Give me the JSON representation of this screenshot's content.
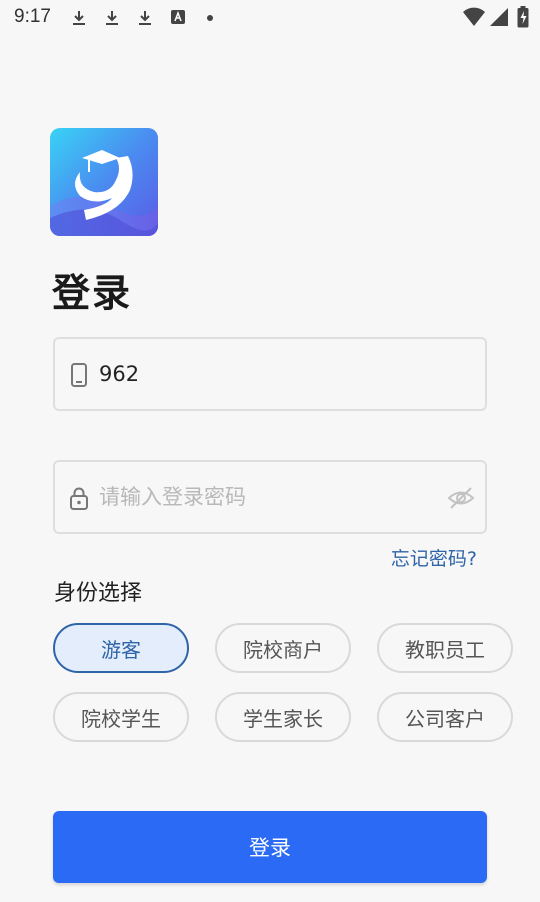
{
  "status_bar": {
    "time": "9:17",
    "icons": [
      "download-icon",
      "download-icon",
      "download-icon",
      "font-icon",
      "dot-icon",
      "wifi-icon",
      "signal-icon",
      "battery-charging-icon"
    ]
  },
  "page": {
    "title": "登录"
  },
  "phone_field": {
    "value": "962",
    "icon": "phone-icon"
  },
  "password_field": {
    "placeholder": "请输入登录密码",
    "icon": "lock-icon",
    "toggle_icon": "eye-off-icon"
  },
  "forgot_password": "忘记密码?",
  "identity": {
    "label": "身份选择",
    "options": [
      "游客",
      "院校商户",
      "教职员工",
      "院校学生",
      "学生家长",
      "公司客户"
    ],
    "selected": "游客"
  },
  "login_button": "登录",
  "colors": {
    "primary": "#2a6af5",
    "link": "#2f64a8",
    "selected_chip_bg": "#e3edfc",
    "background": "#f7f7f7"
  }
}
